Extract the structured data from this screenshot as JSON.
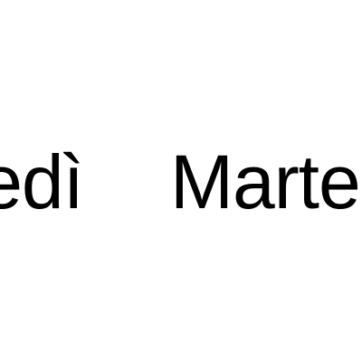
{
  "picker": {
    "items": [
      {
        "label": "edì"
      },
      {
        "label": "Marte"
      }
    ]
  },
  "colors": {
    "background": "#ffffff",
    "text": "#000000"
  }
}
